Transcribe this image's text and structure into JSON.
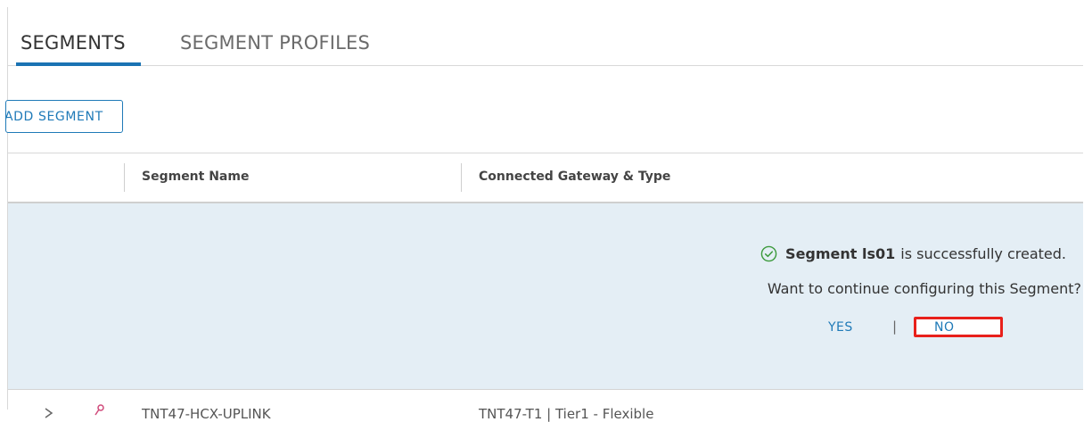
{
  "tabs": {
    "segments": "SEGMENTS",
    "segment_profiles": "SEGMENT PROFILES"
  },
  "toolbar": {
    "add_segment_label": "ADD SEGMENT"
  },
  "table": {
    "columns": [
      "",
      "Segment Name",
      "Connected Gateway & Type"
    ]
  },
  "notification": {
    "icon": "check-circle-icon",
    "prefix": "Segment",
    "segment_name": "ls01",
    "message": "is successfully created.",
    "question": "Want to continue configuring this Segment?",
    "yes_label": "YES",
    "separator": "|",
    "no_label": "NO"
  },
  "next_row": {
    "segment_name": "TNT47-HCX-UPLINK",
    "gateway": "TNT47-T1 | Tier1 - Flexible"
  },
  "colors": {
    "accent": "#1f7ab8",
    "highlight_bg": "#e4eef5",
    "success": "#3c9a3c",
    "annotation_red": "#e8201b"
  }
}
